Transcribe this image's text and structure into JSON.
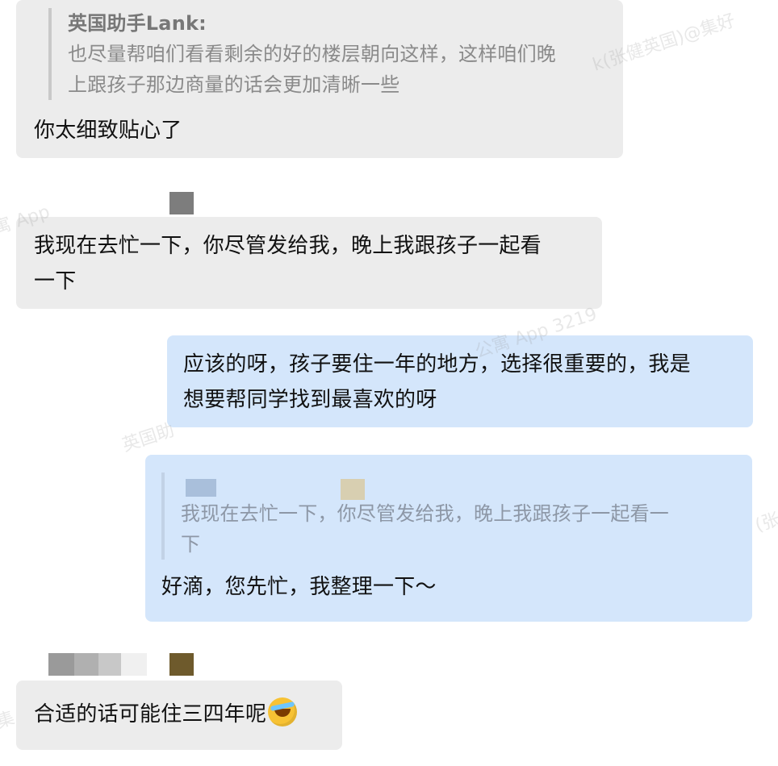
{
  "messages": {
    "m1": {
      "quote_author": "英国助手Lank:",
      "quote_line1": "也尽量帮咱们看看剩余的好的楼层朝向这样，这样咱们晚",
      "quote_line2": "上跟孩子那边商量的话会更加清晰一些",
      "text": "你太细致贴心了"
    },
    "m2": {
      "line1": "我现在去忙一下，你尽管发给我，晚上我跟孩子一起看",
      "line2": "一下"
    },
    "m3": {
      "line1": "应该的呀，孩子要住一年的地方，选择很重要的，我是",
      "line2": "想要帮同学找到最喜欢的呀"
    },
    "m4": {
      "quote_line1": "我现在去忙一下，你尽管发给我，晚上我跟孩子一起看一",
      "quote_line2": "下",
      "text": "好滴，您先忙，我整理一下～"
    },
    "m5": {
      "text": "合适的话可能住三四年呢",
      "emoji": "crying-laughing-emoji"
    }
  },
  "watermarks": {
    "w1": "k(张健英国)@集好",
    "w2": "寓 App",
    "w3": "公寓 App 3219",
    "w4": "英国助",
    "w5": "(张",
    "w6": "集"
  },
  "colors": {
    "incoming_bubble": "#ececec",
    "outgoing_bubble": "#d4e6fb",
    "quote_bar": "#c9c9c9",
    "quote_text": "#8a8a8a"
  }
}
